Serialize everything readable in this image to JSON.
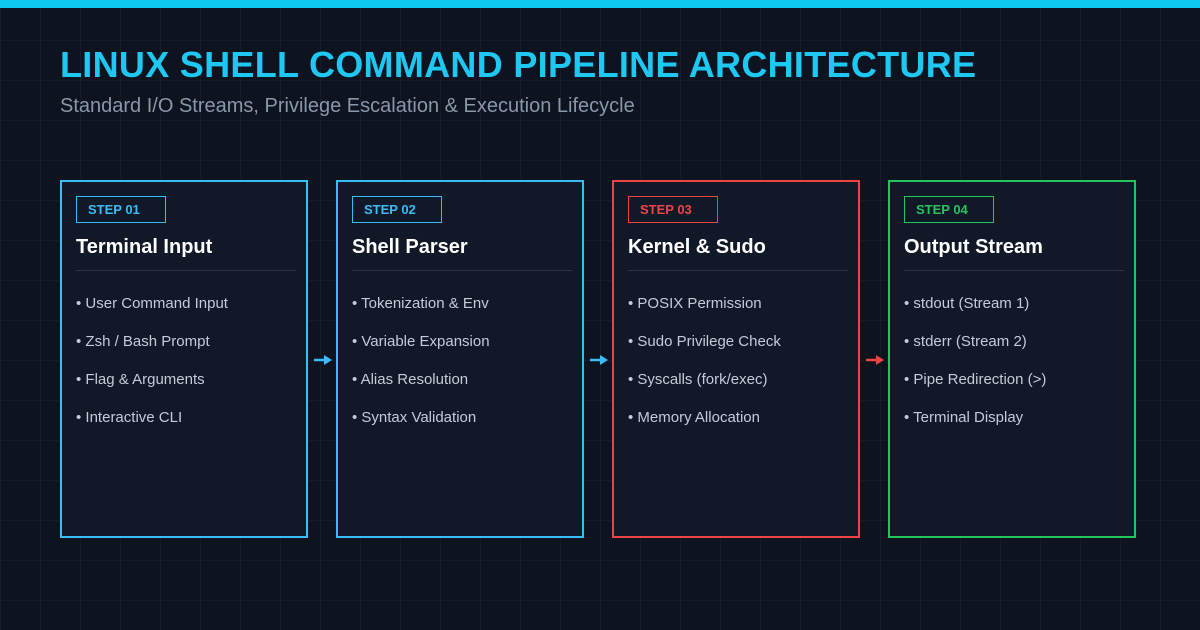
{
  "header": {
    "title": "LINUX SHELL COMMAND PIPELINE ARCHITECTURE",
    "subtitle": "Standard I/O Streams, Privilege Escalation & Execution Lifecycle"
  },
  "colors": {
    "accent": "#1ec8f2",
    "step_blue": "#38bdf8",
    "step_red": "#ef4444",
    "step_green": "#22c55e"
  },
  "steps": [
    {
      "badge": "STEP 01",
      "title": "Terminal Input",
      "color": "#38bdf8",
      "items": [
        "• User Command Input",
        "• Zsh / Bash Prompt",
        "• Flag & Arguments",
        "• Interactive CLI"
      ]
    },
    {
      "badge": "STEP 02",
      "title": "Shell Parser",
      "color": "#38bdf8",
      "items": [
        "• Tokenization & Env",
        "• Variable Expansion",
        "• Alias Resolution",
        "• Syntax Validation"
      ]
    },
    {
      "badge": "STEP 03",
      "title": "Kernel & Sudo",
      "color": "#ef4444",
      "items": [
        "• POSIX Permission",
        "• Sudo Privilege Check",
        "• Syscalls (fork/exec)",
        "• Memory Allocation"
      ]
    },
    {
      "badge": "STEP 04",
      "title": "Output Stream",
      "color": "#22c55e",
      "items": [
        "• stdout (Stream 1)",
        "• stderr (Stream 2)",
        "• Pipe Redirection (>)",
        "• Terminal Display"
      ]
    }
  ],
  "arrows": [
    {
      "color": "#38bdf8",
      "icon": "arrow-right-icon"
    },
    {
      "color": "#38bdf8",
      "icon": "arrow-right-icon"
    },
    {
      "color": "#ef4444",
      "icon": "arrow-right-icon"
    }
  ]
}
